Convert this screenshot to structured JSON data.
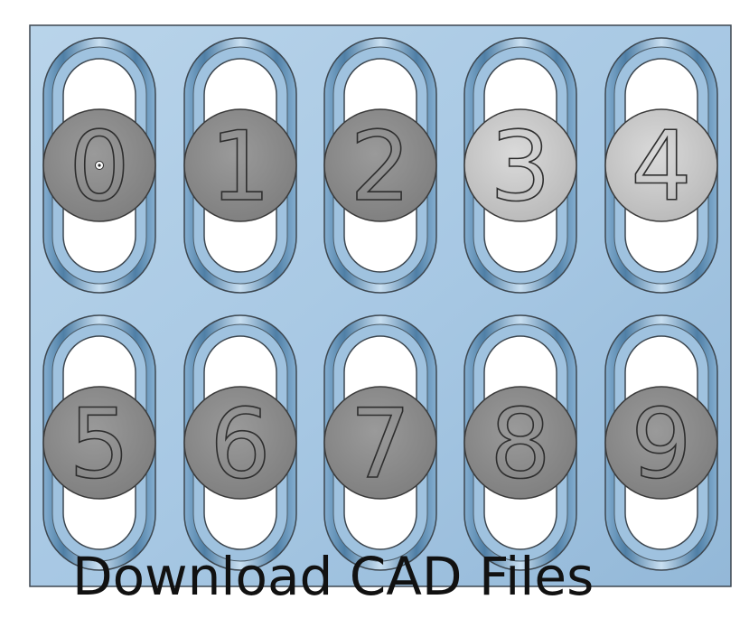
{
  "plate": {
    "labels": [
      "0",
      "1",
      "2",
      "3",
      "4",
      "5",
      "6",
      "7",
      "8",
      "9"
    ],
    "highlighted_labels": [
      "3",
      "4"
    ]
  },
  "cta": {
    "download_label": "Download CAD Files"
  },
  "colors": {
    "plate": "#a7c8e4",
    "plate_edge": "#3d4750",
    "wall": "#5f8fb4",
    "hole": "#ffffff",
    "cap": "#8a8a8a",
    "cap_highlight": "#c7c7c7",
    "text": "#111111"
  }
}
